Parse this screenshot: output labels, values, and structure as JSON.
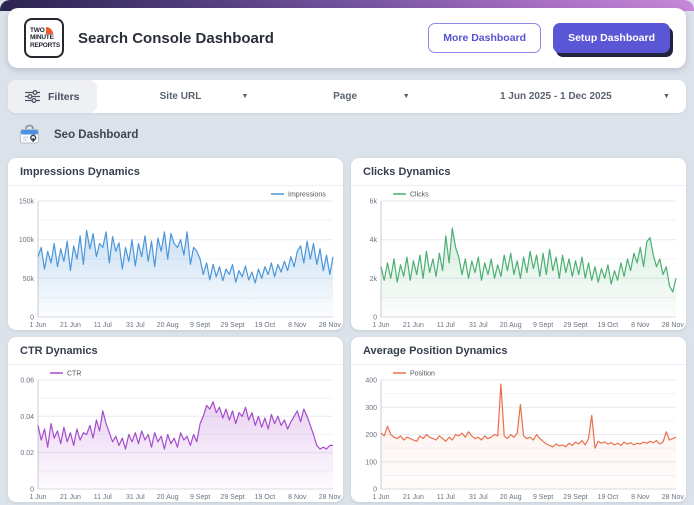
{
  "header": {
    "title": "Search Console Dashboard",
    "logo_lines": [
      "TWO",
      "MINUTE",
      "REPORTS"
    ],
    "more_button": "More Dashboard",
    "setup_button": "Setup Dashboard"
  },
  "filters": {
    "label": "Filters",
    "site_url_label": "Site URL",
    "page_label": "Page",
    "date_range": "1 Jun 2025 - 1 Dec 2025"
  },
  "section": {
    "title": "Seo Dashboard"
  },
  "colors": {
    "accent_purple": "#5a57d6",
    "impressions_blue": "#4d96d9",
    "clicks_green": "#4caf72",
    "ctr_purple": "#a64ccb",
    "position_orange": "#e8714d",
    "topbar_gradient_start": "#2c2450",
    "topbar_gradient_end": "#c887d8"
  },
  "chart_data": [
    {
      "type": "area",
      "title": "Impressions Dynamics",
      "color": "#4d96d9",
      "fill_opacity": 0.3,
      "legend_position": "right",
      "x_tick_labels": [
        "1 Jun",
        "21 Jun",
        "11 Jul",
        "31 Jul",
        "20 Aug",
        "9 Sept",
        "29 Sept",
        "19 Oct",
        "8 Nov",
        "28 Nov"
      ],
      "ylim": [
        0,
        150000
      ],
      "ytick_values": [
        0,
        50000,
        100000,
        150000
      ],
      "ytick_labels": [
        "0",
        "50k",
        "100k",
        "150k"
      ],
      "series": [
        {
          "name": "Impressions",
          "values": [
            78000,
            90000,
            62000,
            85000,
            70000,
            95000,
            65000,
            88000,
            72000,
            98000,
            60000,
            92000,
            75000,
            105000,
            68000,
            112000,
            88000,
            108000,
            78000,
            95000,
            90000,
            110000,
            70000,
            104000,
            85000,
            96000,
            62000,
            90000,
            72000,
            100000,
            66000,
            95000,
            78000,
            105000,
            72000,
            98000,
            65000,
            102000,
            85000,
            110000,
            75000,
            108000,
            95000,
            90000,
            100000,
            80000,
            110000,
            68000,
            90000,
            85000,
            75000,
            55000,
            70000,
            48000,
            68000,
            52000,
            65000,
            47000,
            62000,
            55000,
            68000,
            45000,
            60000,
            52000,
            66000,
            48000,
            58000,
            44000,
            62000,
            50000,
            65000,
            55000,
            70000,
            52000,
            68000,
            58000,
            72000,
            60000,
            78000,
            65000,
            85000,
            92000,
            70000,
            98000,
            75000,
            95000,
            68000,
            88000,
            60000,
            80000,
            55000,
            78000
          ]
        }
      ]
    },
    {
      "type": "area",
      "title": "Clicks Dynamics",
      "color": "#4caf72",
      "fill_opacity": 0.22,
      "legend_position": "left",
      "x_tick_labels": [
        "1 Jun",
        "21 Jun",
        "11 Jul",
        "31 Jul",
        "20 Aug",
        "9 Sept",
        "29 Sept",
        "19 Oct",
        "8 Nov",
        "28 Nov"
      ],
      "ylim": [
        0,
        6000
      ],
      "ytick_values": [
        0,
        2000,
        4000,
        6000
      ],
      "ytick_labels": [
        "0",
        "2k",
        "4k",
        "6k"
      ],
      "series": [
        {
          "name": "Clicks",
          "values": [
            2600,
            1900,
            2800,
            2000,
            3000,
            1800,
            2700,
            2100,
            3100,
            1900,
            2900,
            2200,
            3200,
            2000,
            3400,
            2300,
            3000,
            2100,
            3300,
            2400,
            4200,
            2800,
            4600,
            3600,
            3100,
            2200,
            3000,
            2000,
            2900,
            2300,
            3100,
            1900,
            2800,
            2200,
            3000,
            2000,
            2700,
            2100,
            3200,
            2400,
            3300,
            2200,
            2900,
            2000,
            3100,
            2300,
            3400,
            2500,
            3200,
            2100,
            3300,
            2200,
            3500,
            2400,
            3100,
            2000,
            3200,
            2300,
            3000,
            2100,
            2900,
            2200,
            3100,
            2000,
            2800,
            1900,
            2600,
            1800,
            2500,
            2000,
            2700,
            1700,
            2400,
            1900,
            2800,
            2100,
            3000,
            2400,
            3300,
            2800,
            3600,
            2600,
            3900,
            4100,
            3200,
            2600,
            3000,
            2200,
            2600,
            1600,
            1300,
            2000
          ]
        }
      ]
    },
    {
      "type": "area",
      "title": "CTR Dynamics",
      "color": "#a64ccb",
      "fill_opacity": 0.25,
      "legend_position": "left",
      "x_tick_labels": [
        "1 Jun",
        "21 Jun",
        "11 Jul",
        "31 Jul",
        "20 Aug",
        "9 Sept",
        "29 Sept",
        "19 Oct",
        "8 Nov",
        "28 Nov"
      ],
      "ylim": [
        0,
        0.06
      ],
      "ytick_values": [
        0,
        0.02,
        0.04,
        0.06
      ],
      "ytick_labels": [
        "0",
        "0.02",
        "0.04",
        "0.06"
      ],
      "series": [
        {
          "name": "CTR",
          "values": [
            0.035,
            0.027,
            0.033,
            0.023,
            0.036,
            0.028,
            0.032,
            0.025,
            0.034,
            0.026,
            0.031,
            0.024,
            0.033,
            0.027,
            0.031,
            0.03,
            0.035,
            0.028,
            0.038,
            0.032,
            0.043,
            0.036,
            0.031,
            0.026,
            0.029,
            0.024,
            0.028,
            0.022,
            0.03,
            0.026,
            0.031,
            0.025,
            0.032,
            0.027,
            0.03,
            0.023,
            0.031,
            0.026,
            0.029,
            0.022,
            0.03,
            0.025,
            0.028,
            0.023,
            0.031,
            0.027,
            0.029,
            0.024,
            0.03,
            0.026,
            0.036,
            0.04,
            0.046,
            0.044,
            0.048,
            0.042,
            0.045,
            0.039,
            0.044,
            0.038,
            0.043,
            0.036,
            0.042,
            0.04,
            0.045,
            0.038,
            0.042,
            0.035,
            0.04,
            0.034,
            0.039,
            0.033,
            0.041,
            0.036,
            0.04,
            0.035,
            0.038,
            0.033,
            0.037,
            0.04,
            0.043,
            0.037,
            0.044,
            0.04,
            0.035,
            0.03,
            0.024,
            0.022,
            0.023,
            0.022,
            0.024,
            0.024
          ]
        }
      ]
    },
    {
      "type": "area",
      "title": "Average Position Dynamics",
      "color": "#e8714d",
      "fill_opacity": 0.12,
      "legend_position": "left",
      "x_tick_labels": [
        "1 Jun",
        "21 Jun",
        "11 Jul",
        "31 Jul",
        "20 Aug",
        "9 Sept",
        "29 Sept",
        "19 Oct",
        "8 Nov",
        "28 Nov"
      ],
      "ylim": [
        0,
        400
      ],
      "ytick_values": [
        0,
        100,
        200,
        300,
        400
      ],
      "ytick_labels": [
        "0",
        "100",
        "200",
        "300",
        "400"
      ],
      "series": [
        {
          "name": "Position",
          "values": [
            205,
            195,
            230,
            200,
            190,
            185,
            195,
            180,
            190,
            185,
            180,
            175,
            195,
            185,
            200,
            190,
            185,
            180,
            195,
            185,
            175,
            190,
            180,
            200,
            195,
            205,
            190,
            210,
            195,
            185,
            190,
            180,
            195,
            185,
            190,
            200,
            195,
            385,
            195,
            185,
            200,
            190,
            205,
            310,
            195,
            185,
            190,
            180,
            200,
            185,
            175,
            165,
            160,
            155,
            165,
            158,
            162,
            155,
            168,
            160,
            172,
            165,
            178,
            162,
            185,
            270,
            150,
            175,
            168,
            172,
            165,
            170,
            162,
            168,
            160,
            172,
            165,
            170,
            162,
            168,
            165,
            172,
            168,
            175,
            170,
            178,
            165,
            172,
            210,
            180,
            185,
            190
          ]
        }
      ]
    }
  ]
}
